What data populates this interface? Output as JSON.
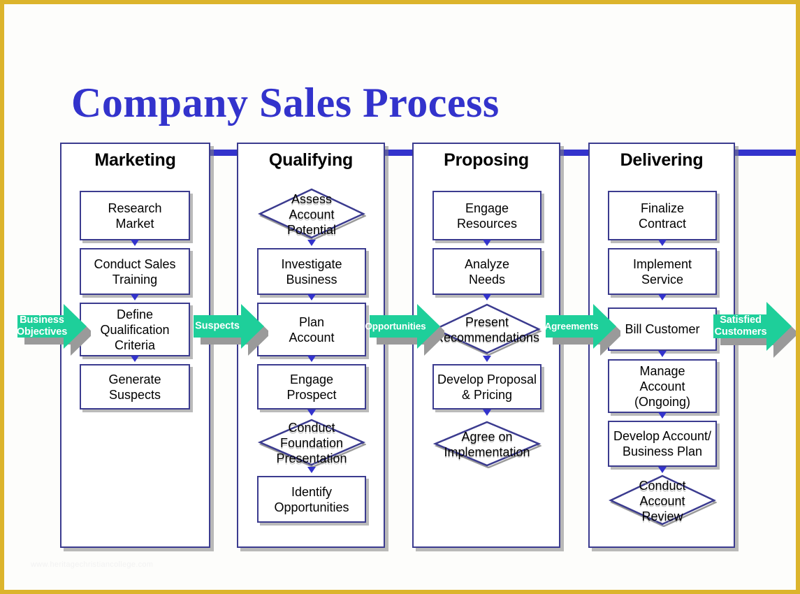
{
  "page": {
    "title": "Company Sales Process",
    "watermark": "www.heritagechristiancollege.com",
    "border_color": "#dcb42c",
    "title_color": "#3333cc",
    "shape_border_color": "#3b3b8f",
    "connector_color": "#3333cc",
    "arrow_color": "#1ecf9a",
    "arrow_label_color": "#ffffff"
  },
  "chart_data": {
    "type": "diagram",
    "title": "Company Sales Process",
    "orientation": "left-to-right stages, top-to-bottom steps",
    "stages": [
      {
        "name": "Marketing",
        "nodes": [
          {
            "label": "Research\nMarket",
            "shape": "process"
          },
          {
            "label": "Conduct Sales\nTraining",
            "shape": "process"
          },
          {
            "label": "Define\nQualification\nCriteria",
            "shape": "process"
          },
          {
            "label": "Generate\nSuspects",
            "shape": "process"
          }
        ]
      },
      {
        "name": "Qualifying",
        "nodes": [
          {
            "label": "Assess\nAccount\nPotential",
            "shape": "decision"
          },
          {
            "label": "Investigate\nBusiness",
            "shape": "process"
          },
          {
            "label": "Plan\nAccount",
            "shape": "process"
          },
          {
            "label": "Engage\nProspect",
            "shape": "process"
          },
          {
            "label": "Conduct\nFoundation\nPresentation",
            "shape": "decision"
          },
          {
            "label": "Identify\nOpportunities",
            "shape": "process"
          }
        ]
      },
      {
        "name": "Proposing",
        "nodes": [
          {
            "label": "Engage\nResources",
            "shape": "process"
          },
          {
            "label": "Analyze\nNeeds",
            "shape": "process"
          },
          {
            "label": "Present\nRecommendations",
            "shape": "decision"
          },
          {
            "label": "Develop Proposal\n& Pricing",
            "shape": "process"
          },
          {
            "label": "Agree on\nImplementation",
            "shape": "decision"
          }
        ]
      },
      {
        "name": "Delivering",
        "nodes": [
          {
            "label": "Finalize\nContract",
            "shape": "process"
          },
          {
            "label": "Implement\nService",
            "shape": "process"
          },
          {
            "label": "Bill Customer",
            "shape": "process"
          },
          {
            "label": "Manage\nAccount\n(Ongoing)",
            "shape": "process"
          },
          {
            "label": "Develop Account/\nBusiness Plan",
            "shape": "process"
          },
          {
            "label": "Conduct\nAccount\nReview",
            "shape": "decision"
          }
        ]
      }
    ],
    "flow_arrows": [
      {
        "label": "Business\nObjectives",
        "position": "input"
      },
      {
        "label": "Suspects",
        "position": "between Marketing and Qualifying"
      },
      {
        "label": "Opportunities",
        "position": "between Qualifying and Proposing"
      },
      {
        "label": "Agreements",
        "position": "between Proposing and Delivering"
      },
      {
        "label": "Satisfied\nCustomers",
        "position": "output"
      }
    ]
  },
  "stages": {
    "marketing": {
      "title": "Marketing",
      "n0": "Research\nMarket",
      "n1": "Conduct Sales\nTraining",
      "n2": "Define\nQualification\nCriteria",
      "n3": "Generate\nSuspects"
    },
    "qualifying": {
      "title": "Qualifying",
      "n0": "Assess\nAccount\nPotential",
      "n1": "Investigate\nBusiness",
      "n2": "Plan\nAccount",
      "n3": "Engage\nProspect",
      "n4": "Conduct\nFoundation\nPresentation",
      "n5": "Identify\nOpportunities"
    },
    "proposing": {
      "title": "Proposing",
      "n0": "Engage\nResources",
      "n1": "Analyze\nNeeds",
      "n2": "Present\nRecommendations",
      "n3": "Develop Proposal\n& Pricing",
      "n4": "Agree on\nImplementation"
    },
    "delivering": {
      "title": "Delivering",
      "n0": "Finalize\nContract",
      "n1": "Implement\nService",
      "n2": "Bill Customer",
      "n3": "Manage\nAccount\n(Ongoing)",
      "n4": "Develop Account/\nBusiness Plan",
      "n5": "Conduct\nAccount\nReview"
    }
  },
  "arrows": {
    "a0": "Business\nObjectives",
    "a1": "Suspects",
    "a2": "Opportunities",
    "a3": "Agreements",
    "a4": "Satisfied\nCustomers"
  }
}
